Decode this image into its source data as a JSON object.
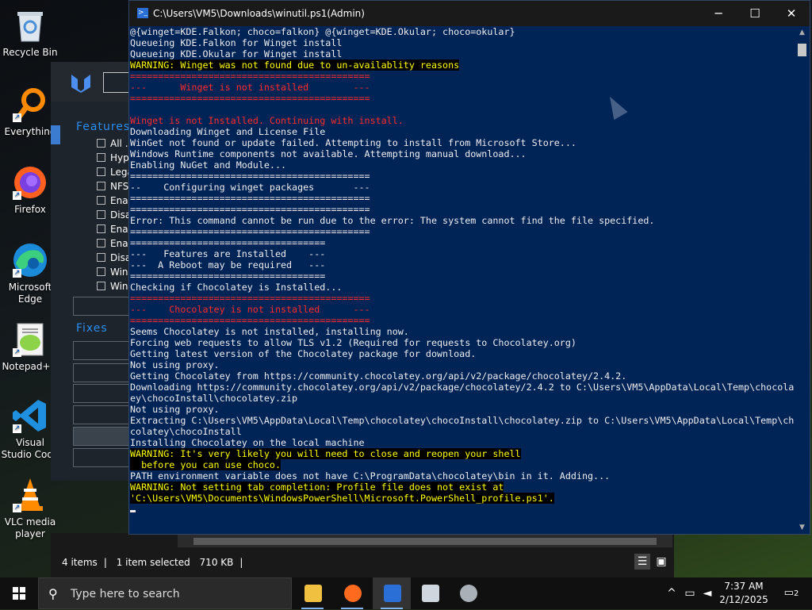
{
  "desktop": {
    "icons": [
      {
        "label": "Recycle Bin",
        "icon": "recycle-bin-icon"
      },
      {
        "label": "Everything",
        "icon": "everything-search-icon"
      },
      {
        "label": "Firefox",
        "icon": "firefox-icon"
      },
      {
        "label": "Microsoft Edge",
        "icon": "edge-icon"
      },
      {
        "label": "Notepad++",
        "icon": "notepadpp-icon"
      },
      {
        "label": "Visual Studio Code",
        "icon": "vscode-icon"
      },
      {
        "label": "VLC media player",
        "icon": "vlc-icon"
      }
    ]
  },
  "winutil": {
    "features_header": "Features",
    "fixes_header": "Fixes",
    "features": [
      "All .N",
      "Hype",
      "Lega",
      "NFS",
      "Enab",
      "Disa",
      "Enab",
      "Enab",
      "Disa",
      "Wind",
      "Wind"
    ]
  },
  "explorer": {
    "item_count": "4 items",
    "selection": "1 item selected",
    "size": "710 KB"
  },
  "powershell": {
    "title": "C:\\Users\\VM5\\Downloads\\winutil.ps1(Admin)",
    "lines": [
      {
        "t": "@{winget=KDE.Falkon; choco=falkon} @{winget=KDE.Okular; choco=okular}",
        "k": "n"
      },
      {
        "t": "Queueing KDE.Falkon for Winget install",
        "k": "n"
      },
      {
        "t": "Queueing KDE.Okular for Winget install",
        "k": "n"
      },
      {
        "t": "WARNING: Winget was not found due to un-availablity reasons",
        "k": "w"
      },
      {
        "t": "===========================================",
        "k": "e"
      },
      {
        "t": "---      Winget is not installed        ---",
        "k": "e"
      },
      {
        "t": "===========================================",
        "k": "e"
      },
      {
        "t": "",
        "k": "n"
      },
      {
        "t": "Winget is not Installed. Continuing with install.",
        "k": "e"
      },
      {
        "t": "Downloading Winget and License File",
        "k": "n"
      },
      {
        "t": "WinGet not found or update failed. Attempting to install from Microsoft Store...",
        "k": "n"
      },
      {
        "t": "Windows Runtime components not available. Attempting manual download...",
        "k": "n"
      },
      {
        "t": "Enabling NuGet and Module...",
        "k": "n"
      },
      {
        "t": "===========================================",
        "k": "n"
      },
      {
        "t": "--    Configuring winget packages       ---",
        "k": "n"
      },
      {
        "t": "===========================================",
        "k": "n"
      },
      {
        "t": "===========================================",
        "k": "n"
      },
      {
        "t": "Error: This command cannot be run due to the error: The system cannot find the file specified.",
        "k": "n"
      },
      {
        "t": "===========================================",
        "k": "n"
      },
      {
        "t": "===================================",
        "k": "n"
      },
      {
        "t": "---   Features are Installed    ---",
        "k": "n"
      },
      {
        "t": "---  A Reboot may be required   ---",
        "k": "n"
      },
      {
        "t": "===================================",
        "k": "n"
      },
      {
        "t": "Checking if Chocolatey is Installed...",
        "k": "n"
      },
      {
        "t": "===========================================",
        "k": "e"
      },
      {
        "t": "---    Chocolatey is not installed      ---",
        "k": "e"
      },
      {
        "t": "===========================================",
        "k": "e"
      },
      {
        "t": "Seems Chocolatey is not installed, installing now.",
        "k": "n"
      },
      {
        "t": "Forcing web requests to allow TLS v1.2 (Required for requests to Chocolatey.org)",
        "k": "n"
      },
      {
        "t": "Getting latest version of the Chocolatey package for download.",
        "k": "n"
      },
      {
        "t": "Not using proxy.",
        "k": "n"
      },
      {
        "t": "Getting Chocolatey from https://community.chocolatey.org/api/v2/package/chocolatey/2.4.2.",
        "k": "n"
      },
      {
        "t": "Downloading https://community.chocolatey.org/api/v2/package/chocolatey/2.4.2 to C:\\Users\\VM5\\AppData\\Local\\Temp\\chocolat",
        "k": "n"
      },
      {
        "t": "ey\\chocoInstall\\chocolatey.zip",
        "k": "n"
      },
      {
        "t": "Not using proxy.",
        "k": "n"
      },
      {
        "t": "Extracting C:\\Users\\VM5\\AppData\\Local\\Temp\\chocolatey\\chocoInstall\\chocolatey.zip to C:\\Users\\VM5\\AppData\\Local\\Temp\\cho",
        "k": "n"
      },
      {
        "t": "colatey\\chocoInstall",
        "k": "n"
      },
      {
        "t": "Installing Chocolatey on the local machine",
        "k": "n"
      },
      {
        "t": "WARNING: It's very likely you will need to close and reopen your shell",
        "k": "w"
      },
      {
        "t": "  before you can use choco.",
        "k": "w"
      },
      {
        "t": "PATH environment variable does not have C:\\ProgramData\\chocolatey\\bin in it. Adding...",
        "k": "n"
      },
      {
        "t": "WARNING: Not setting tab completion: Profile file does not exist at",
        "k": "w"
      },
      {
        "t": "'C:\\Users\\VM5\\Documents\\WindowsPowerShell\\Microsoft.PowerShell_profile.ps1'.",
        "k": "w"
      }
    ]
  },
  "taskbar": {
    "search_placeholder": "Type here to search",
    "time": "7:37 AM",
    "date": "2/12/2025",
    "notifications": "2",
    "apps": [
      "file-explorer-icon",
      "firefox-icon",
      "powershell-icon",
      "network-control-icon",
      "mouse-icon"
    ]
  },
  "colors": {
    "ps_background": "#012456",
    "warning": "#ffff00",
    "error": "#ff2b2b"
  }
}
